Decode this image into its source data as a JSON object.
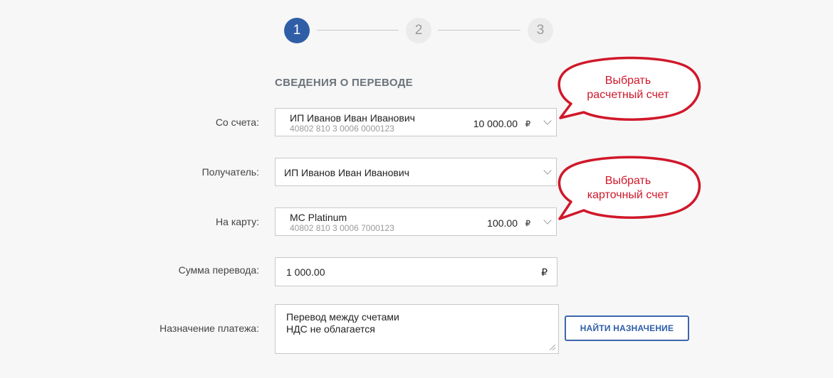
{
  "stepper": {
    "steps": [
      "1",
      "2",
      "3"
    ],
    "active_index": 0
  },
  "form": {
    "title": "СВЕДЕНИЯ О ПЕРЕВОДЕ",
    "from_account": {
      "label": "Со счета:",
      "name": "ИП Иванов Иван Иванович",
      "number": "40802 810 3 0006 0000123",
      "balance": "10 000.00",
      "currency": "₽"
    },
    "recipient": {
      "label": "Получатель:",
      "value": "ИП Иванов Иван Иванович"
    },
    "to_card": {
      "label": "На карту:",
      "name": "MC Platinum",
      "number": "40802 810 3 0006 7000123",
      "balance": "100.00",
      "currency": "₽"
    },
    "amount": {
      "label": "Сумма перевода:",
      "value": "1 000.00",
      "currency": "₽"
    },
    "purpose": {
      "label": "Назначение платежа:",
      "value": "Перевод между счетами\nНДС не облагается"
    },
    "find_purpose_button": "НАЙТИ НАЗНАЧЕНИЕ"
  },
  "callouts": [
    {
      "line1": "Выбрать",
      "line2": "расчетный счет"
    },
    {
      "line1": "Выбрать",
      "line2": "карточный счет"
    }
  ],
  "colors": {
    "accent": "#2f5ea7",
    "callout": "#d0182a"
  }
}
